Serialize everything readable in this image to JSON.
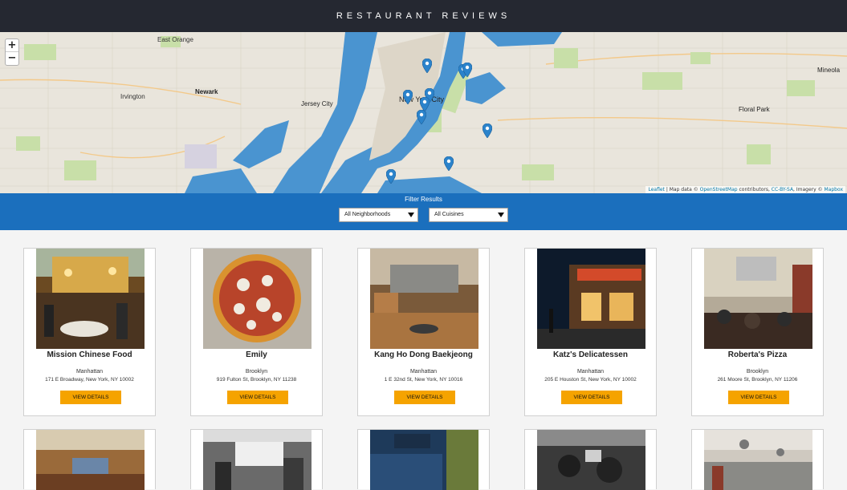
{
  "header": {
    "title": "RESTAURANT REVIEWS"
  },
  "map": {
    "zoom_in": "+",
    "zoom_out": "−",
    "labels": {
      "east_orange": "East Orange",
      "newark": "Newark",
      "irvington": "Irvington",
      "jersey_city": "Jersey City",
      "new_york_city": "New York City",
      "mineola": "Mineola",
      "floral_park": "Floral Park"
    },
    "attribution": {
      "leaflet": "Leaflet",
      "text1": " | Map data © ",
      "osm": "OpenStreetMap",
      "text2": " contributors, ",
      "license": "CC-BY-SA",
      "text3": ", Imagery © ",
      "mapbox": "Mapbox"
    },
    "colors": {
      "land": "#e9e5dc",
      "water": "#4a94d0",
      "park": "#c8dfa8",
      "marker": "#2b83cb"
    }
  },
  "filters": {
    "title": "Filter Results",
    "neighborhood_selected": "All Neighborhoods",
    "cuisine_selected": "All Cuisines"
  },
  "restaurants": [
    {
      "name": "Mission Chinese Food",
      "neighborhood": "Manhattan",
      "address": "171 E Broadway, New York, NY 10002",
      "button": "VIEW DETAILS"
    },
    {
      "name": "Emily",
      "neighborhood": "Brooklyn",
      "address": "919 Fulton St, Brooklyn, NY 11238",
      "button": "VIEW DETAILS"
    },
    {
      "name": "Kang Ho Dong Baekjeong",
      "neighborhood": "Manhattan",
      "address": "1 E 32nd St, New York, NY 10016",
      "button": "VIEW DETAILS"
    },
    {
      "name": "Katz's Delicatessen",
      "neighborhood": "Manhattan",
      "address": "205 E Houston St, New York, NY 10002",
      "button": "VIEW DETAILS"
    },
    {
      "name": "Roberta's Pizza",
      "neighborhood": "Brooklyn",
      "address": "261 Moore St, Brooklyn, NY 11206",
      "button": "VIEW DETAILS"
    }
  ],
  "colors": {
    "header_bg": "#252831",
    "filter_bar": "#1b6fbd",
    "button": "#f5a300"
  }
}
